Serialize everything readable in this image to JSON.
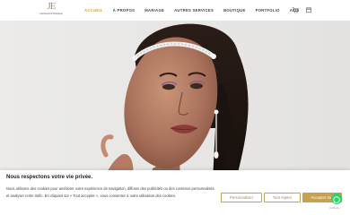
{
  "brand": {
    "mark": "JE",
    "name": "Jamisenda Esthétique"
  },
  "nav": {
    "items": [
      "ACCUEIL",
      "À PROPOS",
      "MARIAGE",
      "AUTRES SERVICES",
      "BOUTIQUE",
      "PORTFOLIO",
      "AVIS"
    ],
    "active_index": 0,
    "icons": [
      "cart-icon",
      "calendar-icon"
    ]
  },
  "hero": {
    "image": "bridal-portrait",
    "hair_accessory": "crystal-headpiece"
  },
  "cookie_banner": {
    "title": "Nous respectons votre vie privée.",
    "text": "Nous utilisons des cookies pour améliorer votre expérience de navigation, diffuser des publicités ou des contenus personnalisés et analyser notre trafic. En cliquant sur « Tout accepter », vous consentez à notre utilisation des cookies.",
    "buttons": {
      "customize": "Personnaliser",
      "reject": "Tout rejeter",
      "accept": "Accepter tout"
    }
  },
  "whatsapp": {
    "label": "GetButton"
  },
  "colors": {
    "accent": "#c9a04f",
    "background": "#ffffff",
    "whatsapp": "#25d366"
  }
}
